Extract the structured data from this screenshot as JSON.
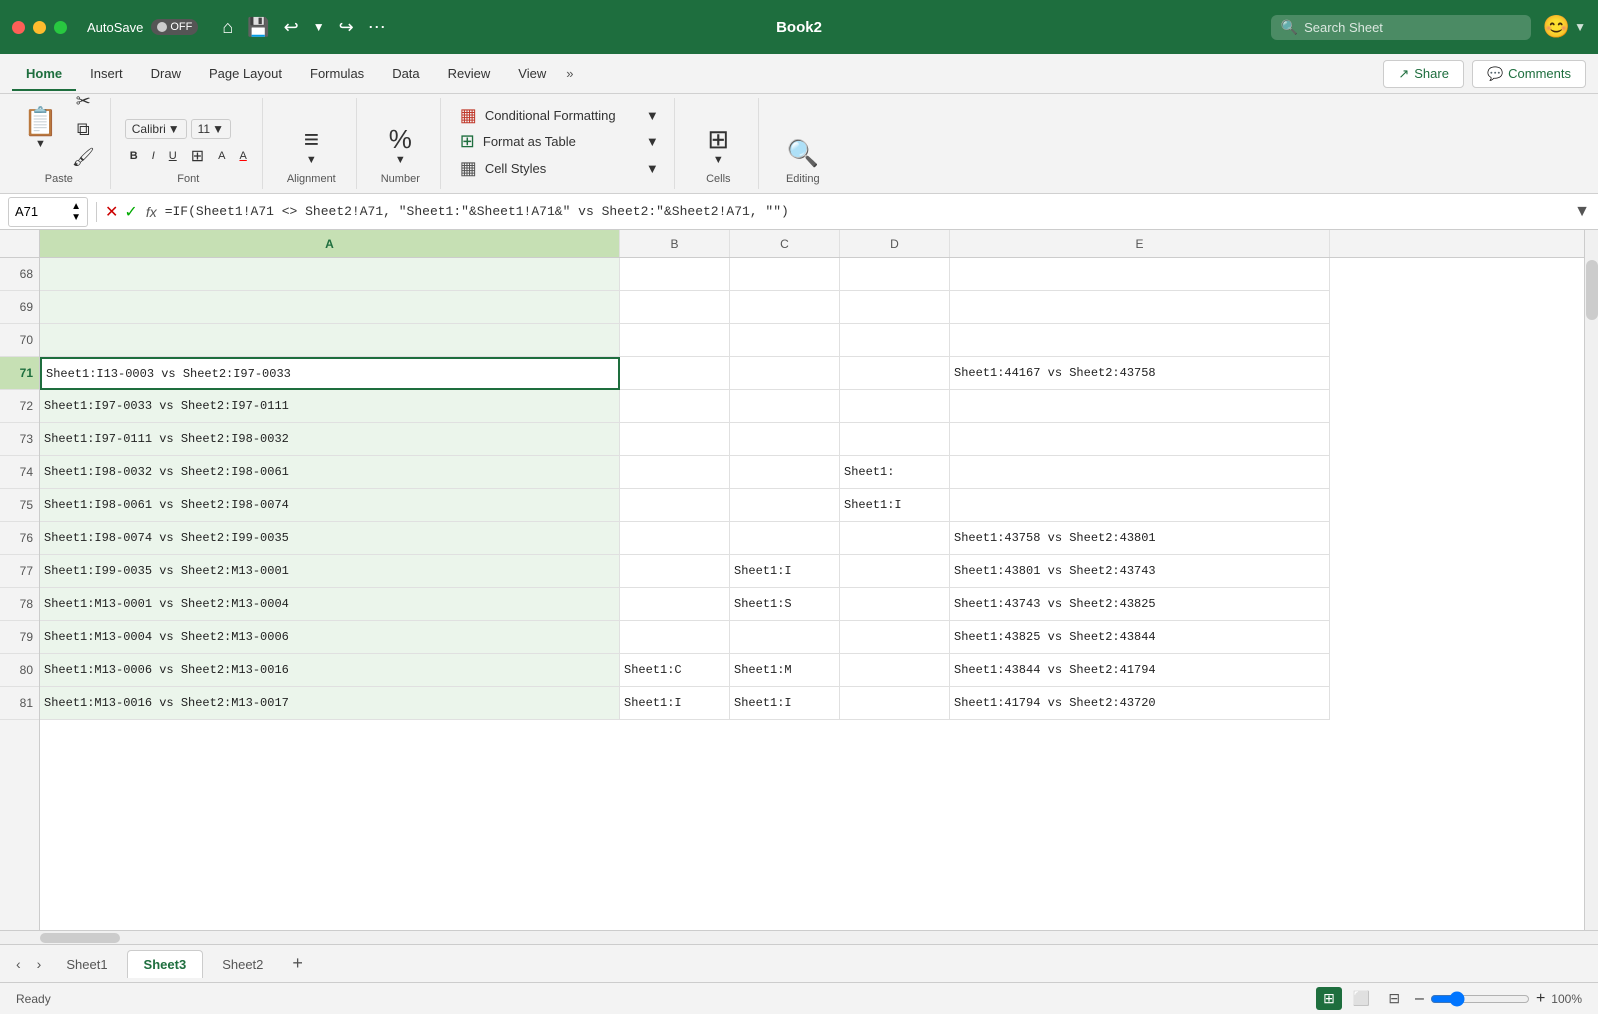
{
  "titleBar": {
    "closeBtn": "×",
    "minimizeBtn": "–",
    "maximizeBtn": "+",
    "autosave": "AutoSave",
    "toggleState": "OFF",
    "title": "Book2",
    "searchPlaceholder": "Search Sheet",
    "homeIcon": "⌂",
    "saveIcon": "💾",
    "undoIcon": "↩",
    "redoIcon": "↪",
    "moreIcon": "⋯"
  },
  "ribbonTabs": {
    "tabs": [
      "Home",
      "Insert",
      "Draw",
      "Page Layout",
      "Formulas",
      "Data",
      "Review",
      "View"
    ],
    "activeTab": "Home",
    "moreIcon": "»",
    "shareLabel": "Share",
    "commentsLabel": "Comments"
  },
  "ribbon": {
    "pasteLabel": "Paste",
    "fontLabel": "Font",
    "alignmentLabel": "Alignment",
    "numberLabel": "Number",
    "conditionalFormatting": "Conditional Formatting",
    "formatAsTable": "Format as Table",
    "cellStyles": "Cell Styles",
    "cellsLabel": "Cells",
    "editingLabel": "Editing"
  },
  "formulaBar": {
    "cellRef": "A71",
    "formula": "=IF(Sheet1!A71 <> Sheet2!A71, \"Sheet1:\"&Sheet1!A71&\" vs Sheet2:\"&Sheet2!A71, \"\")"
  },
  "columns": {
    "headers": [
      "A",
      "B",
      "C",
      "D",
      "E"
    ],
    "widths": [
      580,
      110,
      110,
      110,
      380
    ],
    "activeCol": "A"
  },
  "rows": {
    "startRow": 68,
    "numbers": [
      68,
      69,
      70,
      71,
      72,
      73,
      74,
      75,
      76,
      77,
      78,
      79,
      80,
      81
    ]
  },
  "cellData": {
    "r68": [
      "",
      "",
      "",
      "",
      ""
    ],
    "r69": [
      "",
      "",
      "",
      "",
      ""
    ],
    "r70": [
      "",
      "",
      "",
      "",
      ""
    ],
    "r71": [
      "Sheet1:I13-0003 vs Sheet2:I97-0033",
      "",
      "",
      "",
      "Sheet1:44167 vs Sheet2:43758"
    ],
    "r72": [
      "Sheet1:I97-0033 vs Sheet2:I97-0111",
      "",
      "",
      "",
      ""
    ],
    "r73": [
      "Sheet1:I97-0111 vs Sheet2:I98-0032",
      "",
      "",
      "",
      ""
    ],
    "r74": [
      "Sheet1:I98-0032 vs Sheet2:I98-0061",
      "",
      "",
      "Sheet1:",
      ""
    ],
    "r75": [
      "Sheet1:I98-0061 vs Sheet2:I98-0074",
      "",
      "",
      "Sheet1:I",
      ""
    ],
    "r76": [
      "Sheet1:I98-0074 vs Sheet2:I99-0035",
      "",
      "",
      "",
      "Sheet1:43758 vs Sheet2:43801"
    ],
    "r77": [
      "Sheet1:I99-0035 vs Sheet2:M13-0001",
      "",
      "Sheet1:I",
      "",
      "Sheet1:43801 vs Sheet2:43743"
    ],
    "r78": [
      "Sheet1:M13-0001 vs Sheet2:M13-0004",
      "",
      "Sheet1:S",
      "",
      "Sheet1:43743 vs Sheet2:43825"
    ],
    "r79": [
      "Sheet1:M13-0004 vs Sheet2:M13-0006",
      "",
      "",
      "",
      "Sheet1:43825 vs Sheet2:43844"
    ],
    "r80": [
      "Sheet1:M13-0006 vs Sheet2:M13-0016",
      "Sheet1:C",
      "Sheet1:M",
      "",
      "Sheet1:43844 vs Sheet2:41794"
    ],
    "r81": [
      "Sheet1:M13-0016 vs Sheet2:M13-0017",
      "Sheet1:I",
      "Sheet1:I",
      "",
      "Sheet1:41794 vs Sheet2:43720"
    ]
  },
  "sheetTabs": {
    "tabs": [
      "Sheet1",
      "Sheet3",
      "Sheet2"
    ],
    "activeTab": "Sheet3"
  },
  "statusBar": {
    "status": "Ready"
  },
  "zoom": {
    "level": "100%",
    "zoomIn": "+",
    "zoomOut": "–"
  }
}
